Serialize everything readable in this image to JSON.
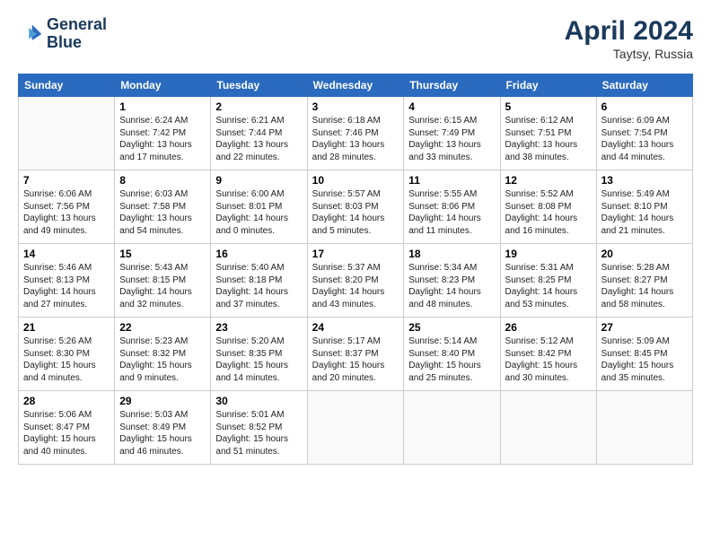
{
  "header": {
    "logo_line1": "General",
    "logo_line2": "Blue",
    "month_year": "April 2024",
    "location": "Taytsy, Russia"
  },
  "days_of_week": [
    "Sunday",
    "Monday",
    "Tuesday",
    "Wednesday",
    "Thursday",
    "Friday",
    "Saturday"
  ],
  "weeks": [
    [
      {
        "num": "",
        "info": ""
      },
      {
        "num": "1",
        "info": "Sunrise: 6:24 AM\nSunset: 7:42 PM\nDaylight: 13 hours\nand 17 minutes."
      },
      {
        "num": "2",
        "info": "Sunrise: 6:21 AM\nSunset: 7:44 PM\nDaylight: 13 hours\nand 22 minutes."
      },
      {
        "num": "3",
        "info": "Sunrise: 6:18 AM\nSunset: 7:46 PM\nDaylight: 13 hours\nand 28 minutes."
      },
      {
        "num": "4",
        "info": "Sunrise: 6:15 AM\nSunset: 7:49 PM\nDaylight: 13 hours\nand 33 minutes."
      },
      {
        "num": "5",
        "info": "Sunrise: 6:12 AM\nSunset: 7:51 PM\nDaylight: 13 hours\nand 38 minutes."
      },
      {
        "num": "6",
        "info": "Sunrise: 6:09 AM\nSunset: 7:54 PM\nDaylight: 13 hours\nand 44 minutes."
      }
    ],
    [
      {
        "num": "7",
        "info": "Sunrise: 6:06 AM\nSunset: 7:56 PM\nDaylight: 13 hours\nand 49 minutes."
      },
      {
        "num": "8",
        "info": "Sunrise: 6:03 AM\nSunset: 7:58 PM\nDaylight: 13 hours\nand 54 minutes."
      },
      {
        "num": "9",
        "info": "Sunrise: 6:00 AM\nSunset: 8:01 PM\nDaylight: 14 hours\nand 0 minutes."
      },
      {
        "num": "10",
        "info": "Sunrise: 5:57 AM\nSunset: 8:03 PM\nDaylight: 14 hours\nand 5 minutes."
      },
      {
        "num": "11",
        "info": "Sunrise: 5:55 AM\nSunset: 8:06 PM\nDaylight: 14 hours\nand 11 minutes."
      },
      {
        "num": "12",
        "info": "Sunrise: 5:52 AM\nSunset: 8:08 PM\nDaylight: 14 hours\nand 16 minutes."
      },
      {
        "num": "13",
        "info": "Sunrise: 5:49 AM\nSunset: 8:10 PM\nDaylight: 14 hours\nand 21 minutes."
      }
    ],
    [
      {
        "num": "14",
        "info": "Sunrise: 5:46 AM\nSunset: 8:13 PM\nDaylight: 14 hours\nand 27 minutes."
      },
      {
        "num": "15",
        "info": "Sunrise: 5:43 AM\nSunset: 8:15 PM\nDaylight: 14 hours\nand 32 minutes."
      },
      {
        "num": "16",
        "info": "Sunrise: 5:40 AM\nSunset: 8:18 PM\nDaylight: 14 hours\nand 37 minutes."
      },
      {
        "num": "17",
        "info": "Sunrise: 5:37 AM\nSunset: 8:20 PM\nDaylight: 14 hours\nand 43 minutes."
      },
      {
        "num": "18",
        "info": "Sunrise: 5:34 AM\nSunset: 8:23 PM\nDaylight: 14 hours\nand 48 minutes."
      },
      {
        "num": "19",
        "info": "Sunrise: 5:31 AM\nSunset: 8:25 PM\nDaylight: 14 hours\nand 53 minutes."
      },
      {
        "num": "20",
        "info": "Sunrise: 5:28 AM\nSunset: 8:27 PM\nDaylight: 14 hours\nand 58 minutes."
      }
    ],
    [
      {
        "num": "21",
        "info": "Sunrise: 5:26 AM\nSunset: 8:30 PM\nDaylight: 15 hours\nand 4 minutes."
      },
      {
        "num": "22",
        "info": "Sunrise: 5:23 AM\nSunset: 8:32 PM\nDaylight: 15 hours\nand 9 minutes."
      },
      {
        "num": "23",
        "info": "Sunrise: 5:20 AM\nSunset: 8:35 PM\nDaylight: 15 hours\nand 14 minutes."
      },
      {
        "num": "24",
        "info": "Sunrise: 5:17 AM\nSunset: 8:37 PM\nDaylight: 15 hours\nand 20 minutes."
      },
      {
        "num": "25",
        "info": "Sunrise: 5:14 AM\nSunset: 8:40 PM\nDaylight: 15 hours\nand 25 minutes."
      },
      {
        "num": "26",
        "info": "Sunrise: 5:12 AM\nSunset: 8:42 PM\nDaylight: 15 hours\nand 30 minutes."
      },
      {
        "num": "27",
        "info": "Sunrise: 5:09 AM\nSunset: 8:45 PM\nDaylight: 15 hours\nand 35 minutes."
      }
    ],
    [
      {
        "num": "28",
        "info": "Sunrise: 5:06 AM\nSunset: 8:47 PM\nDaylight: 15 hours\nand 40 minutes."
      },
      {
        "num": "29",
        "info": "Sunrise: 5:03 AM\nSunset: 8:49 PM\nDaylight: 15 hours\nand 46 minutes."
      },
      {
        "num": "30",
        "info": "Sunrise: 5:01 AM\nSunset: 8:52 PM\nDaylight: 15 hours\nand 51 minutes."
      },
      {
        "num": "",
        "info": ""
      },
      {
        "num": "",
        "info": ""
      },
      {
        "num": "",
        "info": ""
      },
      {
        "num": "",
        "info": ""
      }
    ]
  ]
}
